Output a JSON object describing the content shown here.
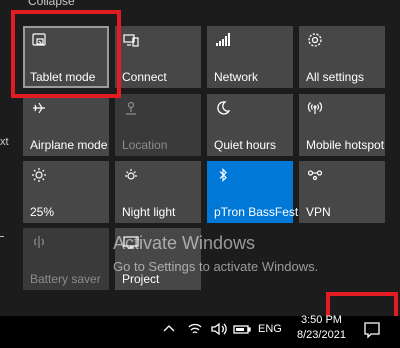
{
  "panel": {
    "collapse_label": "Collapse",
    "edge_text": "xt"
  },
  "tiles": [
    {
      "id": "tablet-mode",
      "label": "Tablet mode",
      "icon": "tablet-mode-icon",
      "state": "focused"
    },
    {
      "id": "connect",
      "label": "Connect",
      "icon": "connect-icon",
      "state": "off"
    },
    {
      "id": "network",
      "label": "Network",
      "icon": "network-icon",
      "state": "off"
    },
    {
      "id": "all-settings",
      "label": "All settings",
      "icon": "gear-icon",
      "state": "off"
    },
    {
      "id": "airplane-mode",
      "label": "Airplane mode",
      "icon": "airplane-icon",
      "state": "off"
    },
    {
      "id": "location",
      "label": "Location",
      "icon": "location-icon",
      "state": "disabled"
    },
    {
      "id": "quiet-hours",
      "label": "Quiet hours",
      "icon": "moon-icon",
      "state": "off"
    },
    {
      "id": "mobile-hotspot",
      "label": "Mobile hotspot",
      "icon": "hotspot-icon",
      "state": "off"
    },
    {
      "id": "brightness",
      "label": "25%",
      "icon": "brightness-icon",
      "state": "off"
    },
    {
      "id": "night-light",
      "label": "Night light",
      "icon": "night-light-icon",
      "state": "off"
    },
    {
      "id": "bluetooth",
      "label": "pTron BassFest",
      "icon": "bluetooth-icon",
      "state": "active"
    },
    {
      "id": "vpn",
      "label": "VPN",
      "icon": "vpn-icon",
      "state": "off"
    },
    {
      "id": "battery-saver",
      "label": "Battery saver",
      "icon": "battery-saver-icon",
      "state": "disabled"
    },
    {
      "id": "project",
      "label": "Project",
      "icon": "project-icon",
      "state": "off"
    }
  ],
  "watermark": {
    "title": "Activate Windows",
    "subtitle": "Go to Settings to activate Windows."
  },
  "taskbar": {
    "language": "ENG",
    "time": "3:50 PM",
    "date": "8/23/2021"
  },
  "colors": {
    "tile": "#474747",
    "tile_active": "#0078d7",
    "highlight": "#e31b23"
  }
}
